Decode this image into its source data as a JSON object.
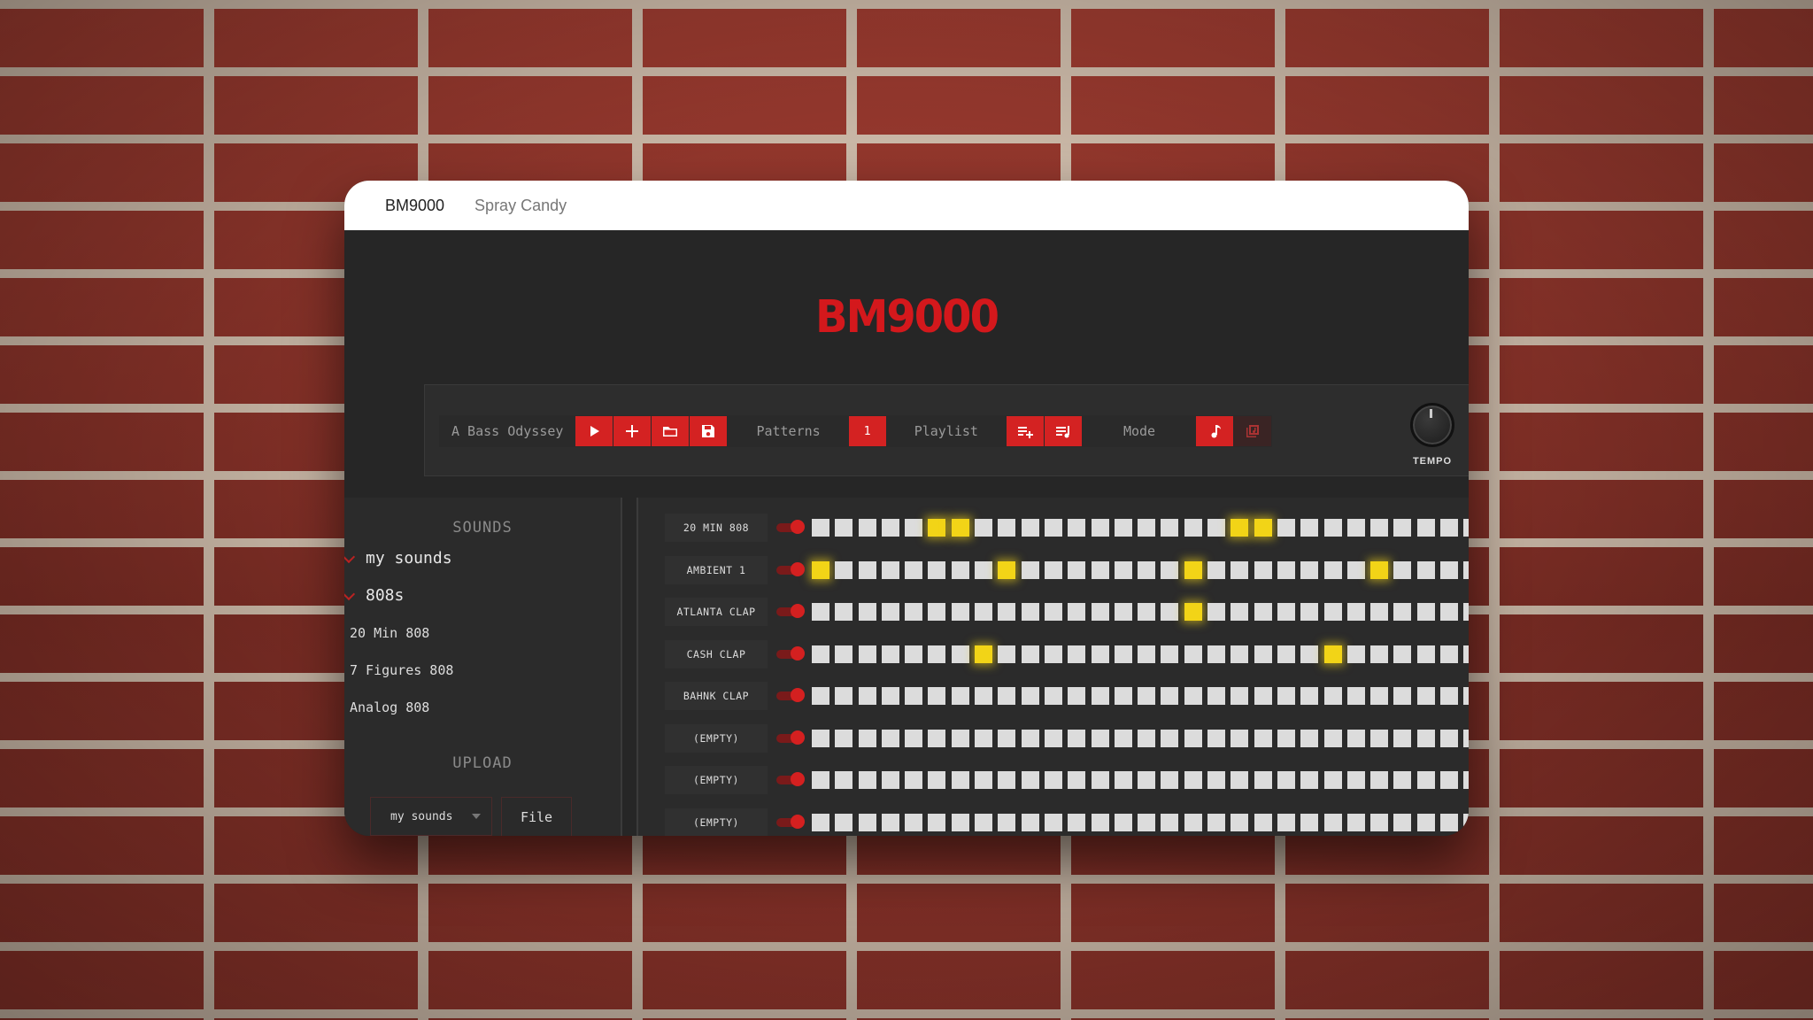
{
  "window": {
    "tabs": [
      "BM9000",
      "Spray Candy"
    ]
  },
  "app": {
    "logo": "BM9000",
    "toolbar": {
      "pattern_name": "A Bass Odyssey",
      "patterns_label": "Patterns",
      "pattern_number": "1",
      "playlist_label": "Playlist",
      "mode_label": "Mode",
      "tempo_label": "TEMPO"
    },
    "sidebar": {
      "sounds_heading": "SOUNDS",
      "folders": [
        "my sounds",
        "808s"
      ],
      "items": [
        "20 Min 808",
        "7 Figures 808",
        "Analog 808"
      ],
      "upload_heading": "UPLOAD",
      "upload_select": "my sounds",
      "upload_file": "File"
    },
    "tracks": [
      {
        "name": "20 MIN 808",
        "active_steps": [
          5,
          6,
          18,
          19
        ]
      },
      {
        "name": "AMBIENT 1",
        "active_steps": [
          0,
          8,
          16,
          24
        ]
      },
      {
        "name": "ATLANTA CLAP",
        "active_steps": [
          16
        ]
      },
      {
        "name": "CASH CLAP",
        "active_steps": [
          7,
          22
        ]
      },
      {
        "name": "BAHNK CLAP",
        "active_steps": []
      },
      {
        "name": "(EMPTY)",
        "active_steps": []
      },
      {
        "name": "(EMPTY)",
        "active_steps": []
      },
      {
        "name": "(EMPTY)",
        "active_steps": []
      }
    ],
    "visible_steps": 29,
    "colors": {
      "accent": "#d42222",
      "step_on": "#f2d417",
      "step_off": "#dcdcdc"
    }
  }
}
